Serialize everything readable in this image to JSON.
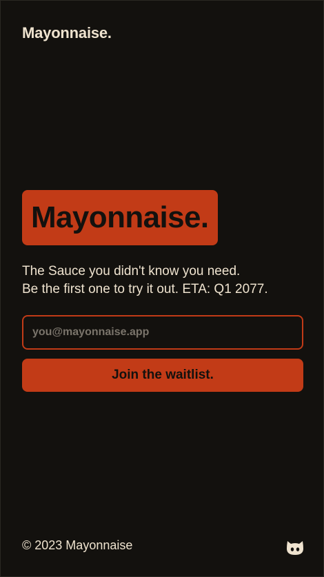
{
  "header": {
    "logo_text": "Mayonnaise."
  },
  "hero": {
    "title": "Mayonnaise.",
    "tagline_line1": "The Sauce you didn't know you need.",
    "tagline_line2": "Be the first one to try it out. ETA: Q1 2077."
  },
  "waitlist": {
    "email_placeholder": "you@mayonnaise.app",
    "email_value": "",
    "button_label": "Join the waitlist."
  },
  "footer": {
    "copyright": "© 2023 Mayonnaise",
    "github_icon": "github-icon"
  },
  "colors": {
    "background": "#13110e",
    "accent": "#c23b17",
    "text": "#efe3cf"
  }
}
